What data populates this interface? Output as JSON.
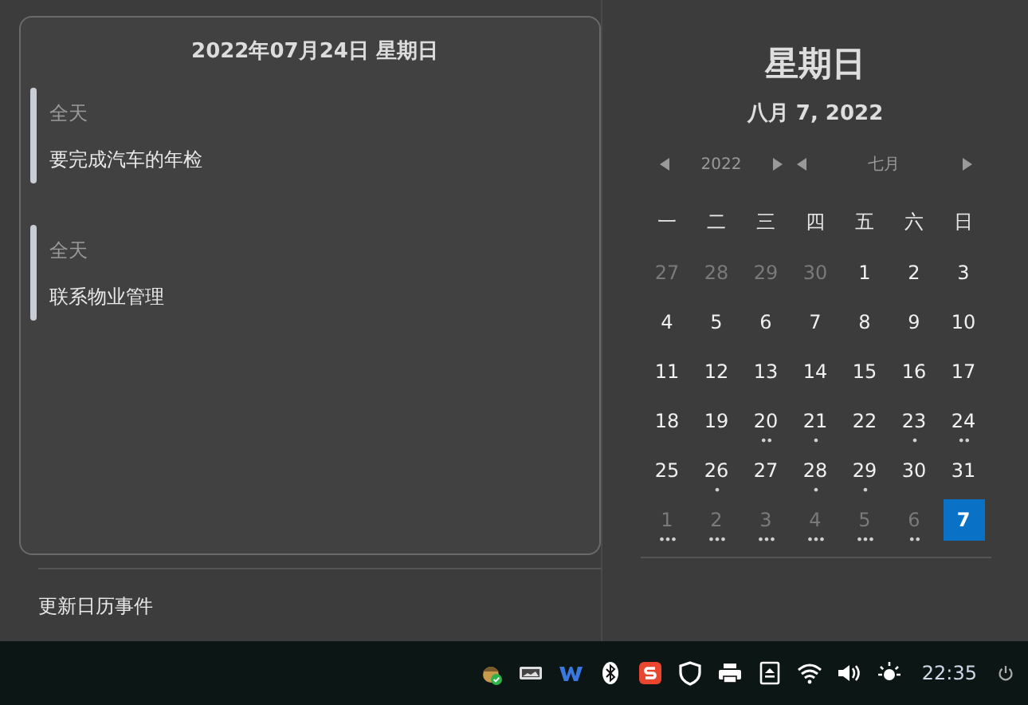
{
  "events_panel": {
    "date_header": "2022年07月24日 星期日",
    "events": [
      {
        "time": "全天",
        "title": "要完成汽车的年检"
      },
      {
        "time": "全天",
        "title": "联系物业管理"
      }
    ],
    "refresh_link": "更新日历事件"
  },
  "calendar": {
    "weekday": "星期日",
    "date": "八月 7, 2022",
    "year": "2022",
    "month": "七月",
    "weekdays": [
      "一",
      "二",
      "三",
      "四",
      "五",
      "六",
      "日"
    ],
    "days": [
      {
        "day": "27",
        "other_month": true,
        "selected": false
      },
      {
        "day": "28",
        "other_month": true,
        "selected": false
      },
      {
        "day": "29",
        "other_month": true,
        "selected": false
      },
      {
        "day": "30",
        "other_month": true,
        "selected": false
      },
      {
        "day": "1",
        "other_month": false,
        "selected": false
      },
      {
        "day": "2",
        "other_month": false,
        "selected": false
      },
      {
        "day": "3",
        "other_month": false,
        "selected": false
      },
      {
        "day": "4",
        "other_month": false,
        "selected": false
      },
      {
        "day": "5",
        "other_month": false,
        "selected": false
      },
      {
        "day": "6",
        "other_month": false,
        "selected": false
      },
      {
        "day": "7",
        "other_month": false,
        "selected": false
      },
      {
        "day": "8",
        "other_month": false,
        "selected": false
      },
      {
        "day": "9",
        "other_month": false,
        "selected": false
      },
      {
        "day": "10",
        "other_month": false,
        "selected": false
      },
      {
        "day": "11",
        "other_month": false,
        "selected": false
      },
      {
        "day": "12",
        "other_month": false,
        "selected": false
      },
      {
        "day": "13",
        "other_month": false,
        "selected": false
      },
      {
        "day": "14",
        "other_month": false,
        "selected": false
      },
      {
        "day": "15",
        "other_month": false,
        "selected": false
      },
      {
        "day": "16",
        "other_month": false,
        "selected": false
      },
      {
        "day": "17",
        "other_month": false,
        "selected": false
      },
      {
        "day": "18",
        "other_month": false,
        "selected": false
      },
      {
        "day": "19",
        "other_month": false,
        "selected": false
      },
      {
        "day": "20",
        "other_month": false,
        "selected": false,
        "dots": "••"
      },
      {
        "day": "21",
        "other_month": false,
        "selected": false,
        "dots": "•"
      },
      {
        "day": "22",
        "other_month": false,
        "selected": false
      },
      {
        "day": "23",
        "other_month": false,
        "selected": false,
        "dots": "•"
      },
      {
        "day": "24",
        "other_month": false,
        "selected": false,
        "dots": "••"
      },
      {
        "day": "25",
        "other_month": false,
        "selected": false
      },
      {
        "day": "26",
        "other_month": false,
        "selected": false,
        "dots": "•"
      },
      {
        "day": "27",
        "other_month": false,
        "selected": false
      },
      {
        "day": "28",
        "other_month": false,
        "selected": false,
        "dots": "•"
      },
      {
        "day": "29",
        "other_month": false,
        "selected": false,
        "dots": "•"
      },
      {
        "day": "30",
        "other_month": false,
        "selected": false
      },
      {
        "day": "31",
        "other_month": false,
        "selected": false
      },
      {
        "day": "1",
        "other_month": true,
        "selected": false,
        "dots": "•••"
      },
      {
        "day": "2",
        "other_month": true,
        "selected": false,
        "dots": "•••"
      },
      {
        "day": "3",
        "other_month": true,
        "selected": false,
        "dots": "•••"
      },
      {
        "day": "4",
        "other_month": true,
        "selected": false,
        "dots": "•••"
      },
      {
        "day": "5",
        "other_month": true,
        "selected": false,
        "dots": "•••"
      },
      {
        "day": "6",
        "other_month": true,
        "selected": false,
        "dots": "••"
      },
      {
        "day": "7",
        "other_month": false,
        "selected": true
      }
    ]
  },
  "taskbar": {
    "tray_icons": [
      {
        "kind": "acorn"
      },
      {
        "kind": "drive"
      },
      {
        "kind": "w"
      },
      {
        "kind": "bluetooth"
      },
      {
        "kind": "s"
      },
      {
        "kind": "shield"
      },
      {
        "kind": "printer"
      },
      {
        "kind": "eject"
      },
      {
        "kind": "wifi"
      },
      {
        "kind": "volume"
      },
      {
        "kind": "brightness"
      }
    ],
    "clock": "22:35"
  }
}
